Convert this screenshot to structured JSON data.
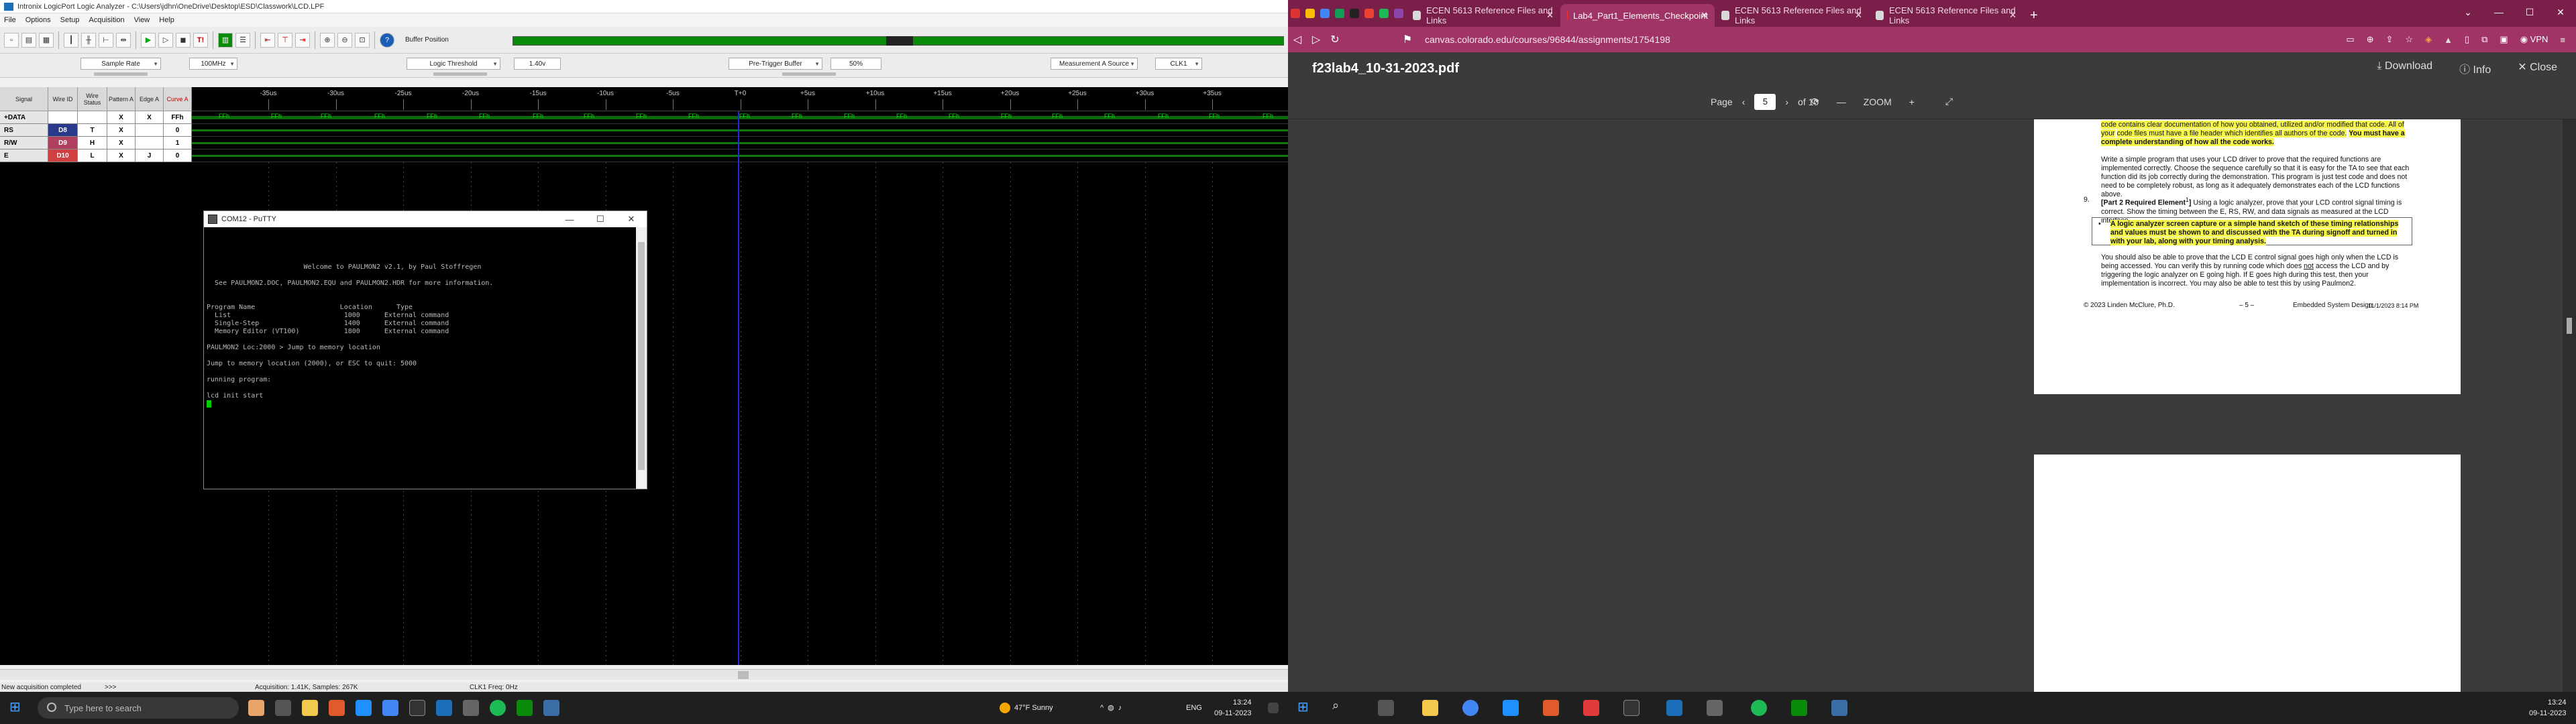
{
  "logic": {
    "title": "Intronix LogicPort Logic Analyzer - C:\\Users\\jdhn\\OneDrive\\Desktop\\ESD\\Classwork\\LCD.LPF",
    "menu": [
      "File",
      "Options",
      "Setup",
      "Acquisition",
      "View",
      "Help"
    ],
    "buffer_label": "Buffer Position",
    "sample_rate_label": "Sample Rate",
    "sample_rate_value": "100MHz",
    "threshold_label": "Logic Threshold",
    "threshold_value": "1.40v",
    "pretrigger_label": "Pre-Trigger Buffer",
    "pretrigger_value": "50%",
    "measure_label": "Measurement A Source",
    "measure_value": "CLK1",
    "grid_headers": [
      "Signal",
      "Wire ID",
      "Wire Status",
      "Pattern A",
      "Edge A",
      "Curve A"
    ],
    "ticks": [
      "-35us",
      "-30us",
      "-25us",
      "-20us",
      "-15us",
      "-10us",
      "-5us",
      "T+0",
      "+5us",
      "+10us",
      "+15us",
      "+20us",
      "+25us",
      "+30us",
      "+35us"
    ],
    "signals": [
      {
        "name": "+DATA",
        "id": "",
        "status": "",
        "pattern": "X",
        "edge": "X",
        "val": "FFh"
      },
      {
        "name": "RS",
        "id": "D8",
        "status": "T",
        "pattern": "X",
        "edge": "",
        "val": "0"
      },
      {
        "name": "R/W",
        "id": "D9",
        "status": "H",
        "pattern": "X",
        "edge": "",
        "val": "1"
      },
      {
        "name": "E",
        "id": "D10",
        "status": "L",
        "pattern": "X",
        "edge": "J",
        "val": "0"
      }
    ],
    "bus_label": "FFh",
    "status_left": "New acquisition completed",
    "status_arrows": ">>>",
    "status_acq": "Acquisition: 1.41K, Samples: 267K",
    "status_clk": "CLK1 Freq: 0Hz"
  },
  "putty": {
    "title": "COM12 - PuTTY",
    "lines": [
      "",
      "",
      "",
      "",
      "                        Welcome to PAULMON2 v2.1, by Paul Stoffregen",
      "",
      "  See PAULMON2.DOC, PAULMON2.EQU and PAULMON2.HDR for more information.",
      "",
      "",
      "Program Name                     Location      Type",
      "  List                            1000      External command",
      "  Single-Step                     1400      External command",
      "  Memory Editor (VT100)           1800      External command",
      "",
      "PAULMON2 Loc:2000 > Jump to memory location",
      "",
      "Jump to memory location (2000), or ESC to quit: 5000",
      "",
      "running program:",
      "",
      "lcd init start"
    ]
  },
  "browser": {
    "tabs": [
      {
        "label": "ECEN 5613 Reference Files and Links",
        "active": false
      },
      {
        "label": "Lab4_Part1_Elements_Checkpoint",
        "active": true
      },
      {
        "label": "ECEN 5613 Reference Files and Links",
        "active": false
      },
      {
        "label": "ECEN 5613 Reference Files and Links",
        "active": false
      }
    ],
    "url": "canvas.colorado.edu/courses/96844/assignments/1754198",
    "vpn": "VPN",
    "pdf_title": "f23lab4_10-31-2023.pdf",
    "download": "Download",
    "info": "Info",
    "close": "Close",
    "page_label": "Page",
    "page_value": "5",
    "page_of": "of 10",
    "zoom_label": "ZOOM",
    "colors": {
      "tabbar": "#7a1f4a",
      "active_tab": "#a13466",
      "highlight": "#f6f64a"
    }
  },
  "pdf": {
    "p_top_1": "code contains clear documentation of how you obtained, utilized and/or modified that code. All of your",
    "p_top_2": "code files must have a file header which identifies all authors of the code.",
    "p_top_bold": "You must have a complete understanding of how all the code works.",
    "p2": "Write a simple program that uses your LCD driver to prove that the required functions are implemented correctly.  Choose the sequence carefully so that it is easy for the TA to see that each function did its job correctly during the demonstration.  This program is just test code and does not need to be completely robust, as long as it adequately demonstrates each of the LCD functions above.",
    "item_num": "9.",
    "item_bold": "[Part 2 Required Element",
    "item_sup": "1",
    "item_bold_end": "]",
    "item_text": "Using a logic analyzer, prove that your LCD control signal timing is correct. Show the timing between the E, RS, RW, and data signals as measured at the LCD interface.",
    "bullet": "A logic analyzer screen capture or a simple hand sketch of these timing relationships and values must be shown to and discussed with the TA during signoff and turned in with your lab, along with your timing analysis.",
    "p4a": "You should also be able to prove that the LCD E control signal goes high only when the LCD is being accessed. You can verify this by running code which does",
    "p4not": "not",
    "p4b": "access the LCD and by triggering the logic analyzer on E going high. If E goes high during this test, then your implementation is incorrect. You may also be able to test this by using Paulmon2.",
    "foot_left": "© 2023 Linden McClure, Ph.D.",
    "foot_mid": "– 5 –",
    "foot_right": "Embedded System Design",
    "foot_date": "11/1/2023 8:14 PM"
  },
  "taskbar": {
    "search": "Type here to search",
    "weather": "47°F  Sunny",
    "lang": "ENG",
    "time_left": "13:24",
    "date_left": "09-11-2023",
    "time_right": "13:24",
    "date_right": "09-11-2023"
  }
}
